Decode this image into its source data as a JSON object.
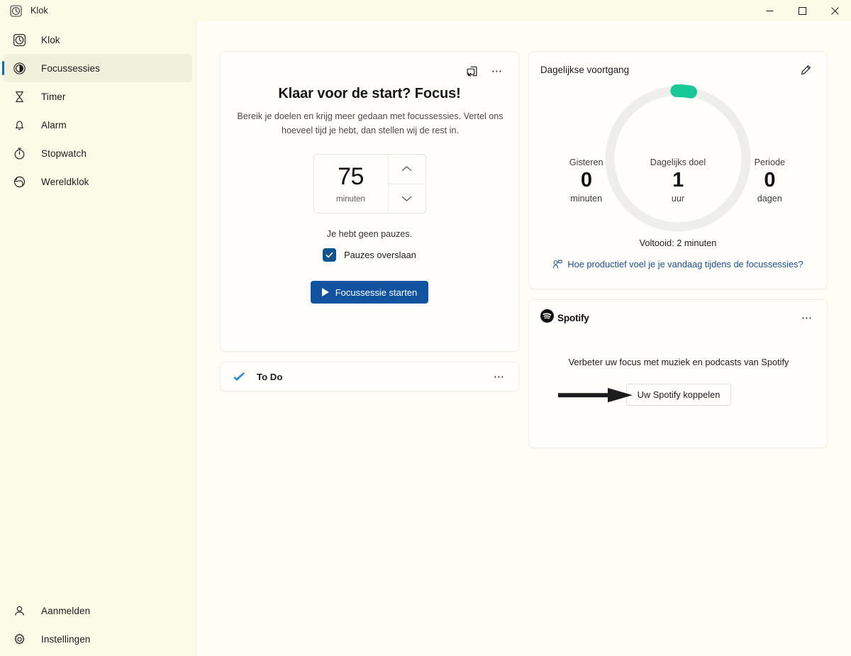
{
  "window": {
    "app_icon": "clock-icon",
    "title": "Klok",
    "controls": {
      "minimize": "minimize-icon",
      "maximize": "maximize-icon",
      "close": "close-icon"
    }
  },
  "sidebar": {
    "items": [
      {
        "icon": "clock-icon",
        "label": "Klok",
        "selected": false
      },
      {
        "icon": "focus-icon",
        "label": "Focussessies",
        "selected": true
      },
      {
        "icon": "hourglass-icon",
        "label": "Timer",
        "selected": false
      },
      {
        "icon": "bell-icon",
        "label": "Alarm",
        "selected": false
      },
      {
        "icon": "stopwatch-icon",
        "label": "Stopwatch",
        "selected": false
      },
      {
        "icon": "globe-icon",
        "label": "Wereldklok",
        "selected": false
      }
    ],
    "bottom_items": [
      {
        "icon": "person-icon",
        "label": "Aanmelden"
      },
      {
        "icon": "gear-icon",
        "label": "Instellingen"
      }
    ]
  },
  "focus_card": {
    "popout_icon": "mini-view-icon",
    "more_icon": "more-options-icon",
    "title": "Klaar voor de start? Focus!",
    "subtitle": "Bereik je doelen en krijg meer gedaan met focussessies. Vertel ons hoeveel tijd je hebt, dan stellen wij de rest in.",
    "spinner": {
      "value": "75",
      "unit": "minuten",
      "increase_icon": "chevron-up-icon",
      "decrease_icon": "chevron-down-icon"
    },
    "breaks_note": "Je hebt geen pauzes.",
    "skip_breaks_label": "Pauzes overslaan",
    "skip_breaks_checked": true,
    "start_button": "Focussessie starten",
    "accent_color": "#11539e"
  },
  "todo_card": {
    "logo": "todo-checkmark-icon",
    "label": "To Do",
    "more_icon": "more-options-icon"
  },
  "progress_card": {
    "title": "Dagelijkse voortgang",
    "edit_icon": "pencil-edit-icon",
    "stats": [
      {
        "label": "Gisteren",
        "value": "0",
        "unit": "minuten"
      },
      {
        "label": "Dagelijks doel",
        "value": "1",
        "unit": "uur"
      },
      {
        "label": "Periode",
        "value": "0",
        "unit": "dagen"
      }
    ],
    "completed_text": "Voltooid: 2 minuten",
    "feedback_link": "Hoe productief voel je je vandaag tijdens de focussessies?",
    "feedback_icon": "feedback-icon",
    "ring": {
      "progress_percent": 3.3,
      "track_color": "#eeeeea",
      "progress_color": "#18c896"
    }
  },
  "spotify_card": {
    "logo_icon": "spotify-icon",
    "brand": "Spotify",
    "more_icon": "more-options-icon",
    "description": "Verbeter uw focus met muziek en podcasts van Spotify",
    "connect_button": "Uw Spotify koppelen",
    "annotation": "arrow-pointer-annotation"
  }
}
